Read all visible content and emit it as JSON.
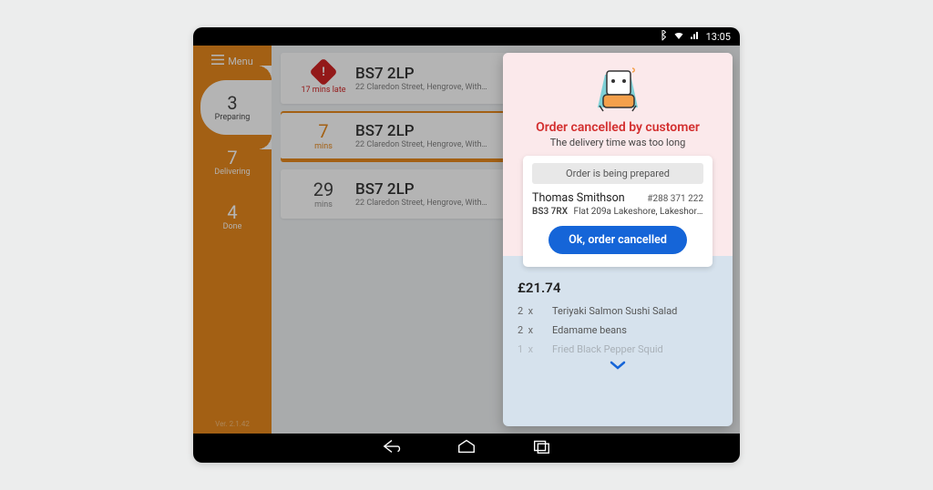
{
  "statusbar": {
    "time": "13:05"
  },
  "sidebar": {
    "menu_label": "Menu",
    "tabs": [
      {
        "count": "3",
        "label": "Preparing"
      },
      {
        "count": "7",
        "label": "Delivering"
      },
      {
        "count": "4",
        "label": "Done"
      }
    ],
    "version": "Ver. 2.1.42"
  },
  "orders": [
    {
      "late_text": "17 mins late",
      "postcode": "BS7 2LP",
      "address": "22 Claredon Street, Hengrove, With…"
    },
    {
      "mins": "7",
      "mins_label": "mins",
      "postcode": "BS7 2LP",
      "address": "22 Claredon Street, Hengrove, With…"
    },
    {
      "mins": "29",
      "mins_label": "mins",
      "postcode": "BS7 2LP",
      "address": "22 Claredon Street, Hengrove, With…"
    }
  ],
  "detail": {
    "cancel_title": "Order cancelled by customer",
    "cancel_sub": "The delivery time was too long",
    "status_pill": "Order is being prepared",
    "customer_name": "Thomas Smithson",
    "order_id": "#288 371 222",
    "postcode": "BS3 7RX",
    "address": "Flat 209a Lakeshore, Lakeshore…",
    "ok_label": "Ok, order cancelled",
    "total": "£21.74",
    "items": [
      {
        "qty": "2",
        "x": "x",
        "name": "Teriyaki Salmon Sushi Salad"
      },
      {
        "qty": "2",
        "x": "x",
        "name": "Edamame beans"
      },
      {
        "qty": "1",
        "x": "x",
        "name": "Fried Black Pepper Squid"
      }
    ]
  }
}
